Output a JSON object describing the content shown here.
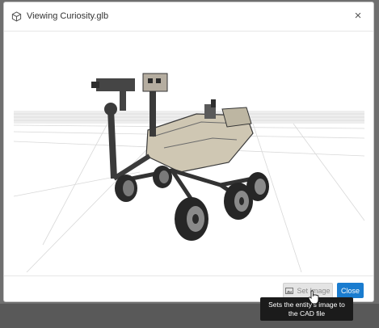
{
  "dialog": {
    "title": "Viewing Curiosity.glb",
    "close_glyph": "×",
    "header_icon": "cube-icon"
  },
  "viewer": {
    "model_subject": "mars-rover-3d-model"
  },
  "footer": {
    "set_image_label": "Set Image",
    "set_image_icon": "image-icon",
    "close_label": "Close"
  },
  "tooltip": {
    "text": "Sets the entity's image to the CAD file"
  },
  "colors": {
    "primary": "#1a7ccf",
    "tooltip_bg": "#1b1b1b"
  }
}
